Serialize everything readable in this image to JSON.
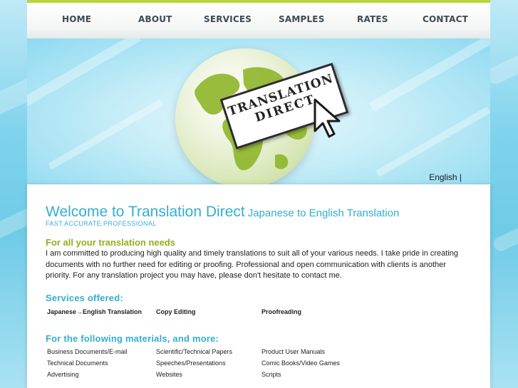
{
  "nav": {
    "items": [
      "HOME",
      "ABOUT",
      "SERVICES",
      "SAMPLES",
      "RATES",
      "CONTACT"
    ]
  },
  "hero": {
    "sign_line1": "TRANSLATION",
    "sign_line2": "DIRECT",
    "language_link": "English |"
  },
  "content": {
    "welcome_title": "Welcome to Translation Direct",
    "welcome_subtitle": "Japanese to English Translation",
    "tagline": "FAST.ACCURATE.PROFESSIONAL",
    "needs_heading": "For all your translation needs",
    "intro_text": "I am committed to producing high quality and timely translations to suit all of your various needs. I take pride in creating documents with no further need for editing or proofing. Professional and open communication with clients is another priority. For any translation project you may have, please don't hesitate to contact me.",
    "services_heading": "Services offered:",
    "services": [
      "Japanese→English Translation",
      "Copy Editing",
      "Proofreading"
    ],
    "materials_heading": "For the following materials, and more:",
    "materials": [
      [
        "Business Documents/E-mail",
        "Scientific/Technical Papers",
        "Product User Manuals"
      ],
      [
        "Technical Documents",
        "Speeches/Presentations",
        "Comic Books/Video Games"
      ],
      [
        "Advertising",
        "Websites",
        "Scripts"
      ]
    ]
  },
  "colors": {
    "accent_blue": "#33aed0",
    "accent_green": "#8db21a",
    "nav_text": "#3b4a52"
  }
}
